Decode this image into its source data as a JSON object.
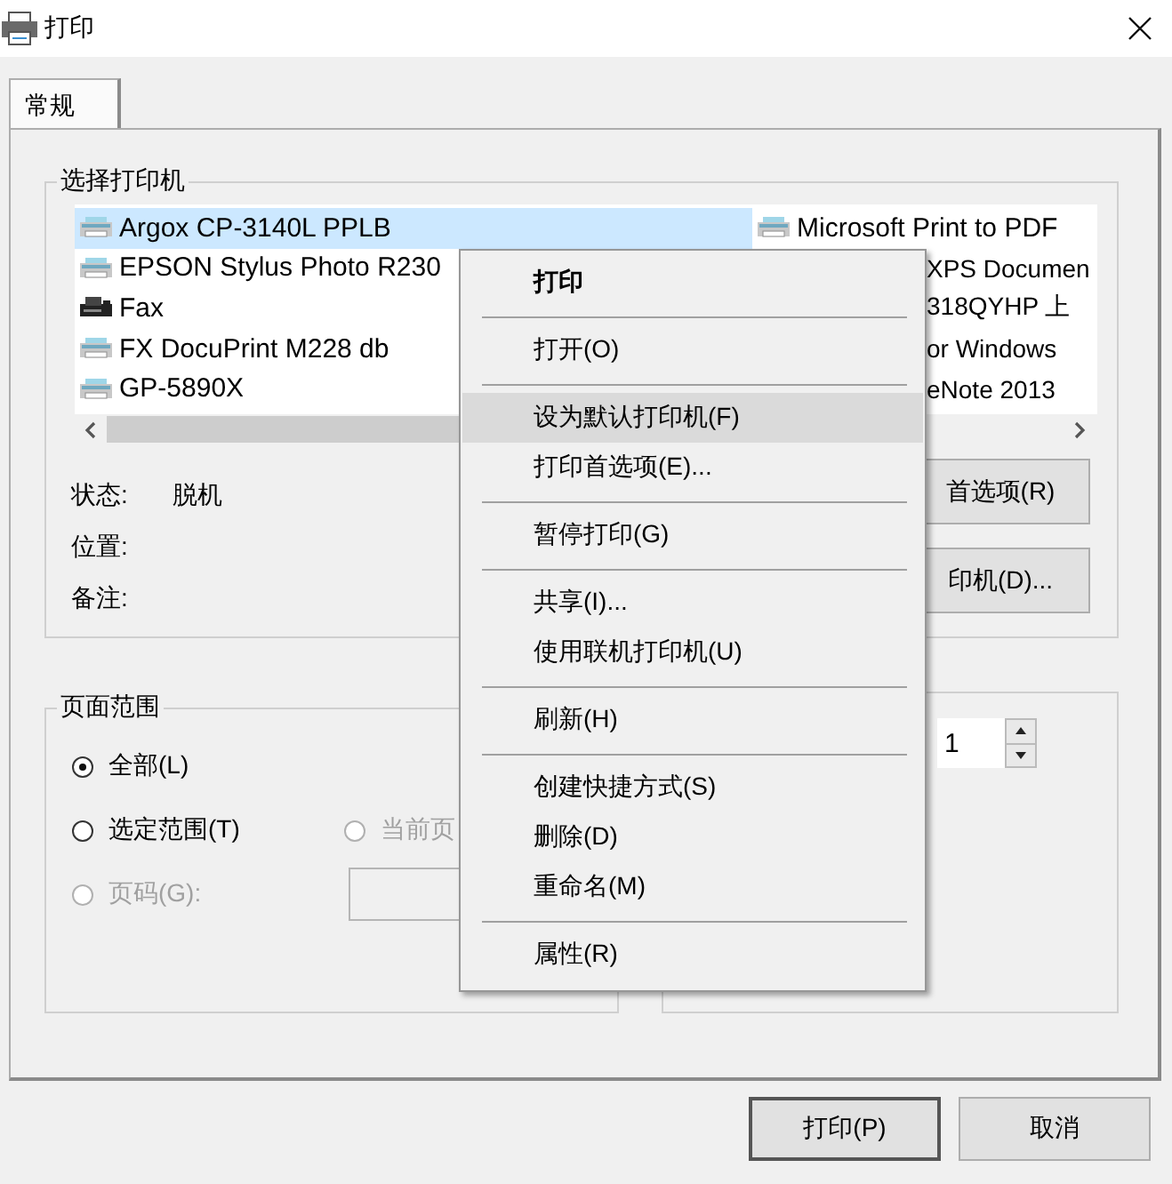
{
  "window": {
    "title": "打印"
  },
  "tabs": [
    {
      "label": "常规",
      "selected": true
    }
  ],
  "printer_group": {
    "title": "选择打印机",
    "printers": [
      {
        "name": "Argox CP-3140L PPLB",
        "kind": "printer",
        "selected": true
      },
      {
        "name": "EPSON Stylus Photo R230",
        "kind": "printer",
        "selected": false
      },
      {
        "name": "Fax",
        "kind": "fax",
        "selected": false
      },
      {
        "name": "FX DocuPrint M228 db",
        "kind": "printer",
        "selected": false
      },
      {
        "name": "GP-5890X",
        "kind": "printer",
        "selected": false
      },
      {
        "name": "Microsoft Print to PDF",
        "kind": "printer",
        "selected": false
      },
      {
        "name": "XPS Documen",
        "kind": "fragment",
        "selected": false
      },
      {
        "name": "318QYHP 上",
        "kind": "fragment",
        "selected": false
      },
      {
        "name": "or Windows",
        "kind": "fragment",
        "selected": false
      },
      {
        "name": "eNote 2013",
        "kind": "fragment",
        "selected": false
      }
    ],
    "fields": [
      {
        "label": "状态:",
        "value": "脱机"
      },
      {
        "label": "位置:"
      },
      {
        "label": "备注:"
      }
    ],
    "buttons": [
      "首选项(R)",
      "印机(D)..."
    ]
  },
  "page_range": {
    "title": "页面范围",
    "options": [
      {
        "label": "全部(L)",
        "selected": true,
        "disabled": false
      },
      {
        "label": "选定范围(T)",
        "selected": false,
        "disabled": false
      },
      {
        "label": "当前页",
        "selected": false,
        "disabled": true
      },
      {
        "label": "页码(G):",
        "selected": false,
        "disabled": true
      }
    ],
    "pages_field": {
      "disabled": true
    }
  },
  "copies": {
    "value": "1"
  },
  "context_menu": {
    "items": [
      {
        "kind": "item",
        "label": "打印",
        "default": true,
        "selected": false
      },
      {
        "kind": "separator"
      },
      {
        "kind": "item",
        "label": "打开(O)",
        "default": false,
        "selected": false
      },
      {
        "kind": "separator"
      },
      {
        "kind": "item",
        "label": "设为默认打印机(F)",
        "default": false,
        "selected": true
      },
      {
        "kind": "item",
        "label": "打印首选项(E)...",
        "default": false,
        "selected": false
      },
      {
        "kind": "separator"
      },
      {
        "kind": "item",
        "label": "暂停打印(G)",
        "default": false,
        "selected": false
      },
      {
        "kind": "separator"
      },
      {
        "kind": "item",
        "label": "共享(I)...",
        "default": false,
        "selected": false
      },
      {
        "kind": "item",
        "label": "使用联机打印机(U)",
        "default": false,
        "selected": false
      },
      {
        "kind": "separator"
      },
      {
        "kind": "item",
        "label": "刷新(H)",
        "default": false,
        "selected": false
      },
      {
        "kind": "separator"
      },
      {
        "kind": "item",
        "label": "创建快捷方式(S)",
        "default": false,
        "selected": false
      },
      {
        "kind": "item",
        "label": "删除(D)",
        "default": false,
        "selected": false
      },
      {
        "kind": "item",
        "label": "重命名(M)",
        "default": false,
        "selected": false
      },
      {
        "kind": "separator"
      },
      {
        "kind": "item",
        "label": "属性(R)",
        "default": false,
        "selected": false
      }
    ]
  },
  "buttons": [
    {
      "label": "打印(P)",
      "default": true
    },
    {
      "label": "取消",
      "default": false
    }
  ]
}
